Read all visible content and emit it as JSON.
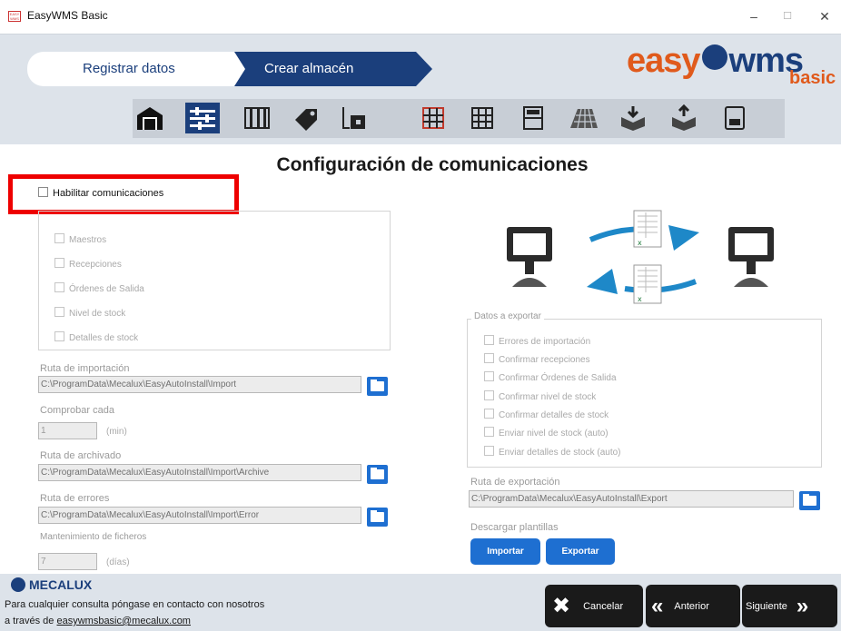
{
  "window": {
    "title": "EasyWMS Basic",
    "app_icon_text": "EASY WMS",
    "minimize": "–",
    "maximize": "☐",
    "close": "✕"
  },
  "wizard": {
    "step1": "Registrar datos",
    "step2": "Crear almacén"
  },
  "logo": {
    "text_a": "easy",
    "text_b": "wms",
    "text_c": "basic"
  },
  "toolbar": {
    "icons": [
      "warehouse-icon",
      "settings-sliders-icon",
      "shelving-icon",
      "tag-icon",
      "forklift-icon",
      "grid-red-icon",
      "grid-icon",
      "shelf-icon",
      "floor-pattern-icon",
      "box-down-icon",
      "box-up-icon",
      "save-icon"
    ]
  },
  "page_title": "Configuración de comunicaciones",
  "enable": {
    "label": "Habilitar comunicaciones",
    "checked": false
  },
  "import_options": [
    "Maestros",
    "Recepciones",
    "Órdenes de Salida",
    "Nivel de stock",
    "Detalles de stock"
  ],
  "import_path": {
    "label": "Ruta de importación",
    "value": "C:\\ProgramData\\Mecalux\\EasyAutoInstall\\Import"
  },
  "check_every": {
    "label": "Comprobar cada",
    "value": "1",
    "unit": "(min)"
  },
  "archive_path": {
    "label": "Ruta de archivado",
    "value": "C:\\ProgramData\\Mecalux\\EasyAutoInstall\\Import\\Archive"
  },
  "error_path": {
    "label": "Ruta de errores",
    "value": "C:\\ProgramData\\Mecalux\\EasyAutoInstall\\Import\\Error"
  },
  "maintenance": {
    "label": "Mantenimiento de ficheros",
    "value": "7",
    "unit": "(días)"
  },
  "export_group": {
    "legend": "Datos a exportar",
    "options": [
      "Errores de importación",
      "Confirmar recepciones",
      "Confirmar Órdenes de Salida",
      "Confirmar nivel de stock",
      "Confirmar detalles de stock",
      "Enviar nivel de stock (auto)",
      "Enviar detalles de stock (auto)"
    ]
  },
  "export_path": {
    "label": "Ruta de exportación",
    "value": "C:\\ProgramData\\Mecalux\\EasyAutoInstall\\Export"
  },
  "templates": {
    "label": "Descargar plantillas",
    "import_button": "Importar",
    "export_button": "Exportar"
  },
  "footer": {
    "brand": "MECALUX",
    "line1": "Para cualquier consulta póngase en contacto con nosotros",
    "line2_prefix": "a través de ",
    "email": "easywmsbasic@mecalux.com"
  },
  "nav": {
    "cancel": "Cancelar",
    "previous": "Anterior",
    "next": "Siguiente"
  },
  "colors": {
    "brand_blue": "#1b3f7c",
    "brand_orange": "#e05a1c",
    "button_blue": "#1e6fd1",
    "highlight_red": "#e00000"
  }
}
